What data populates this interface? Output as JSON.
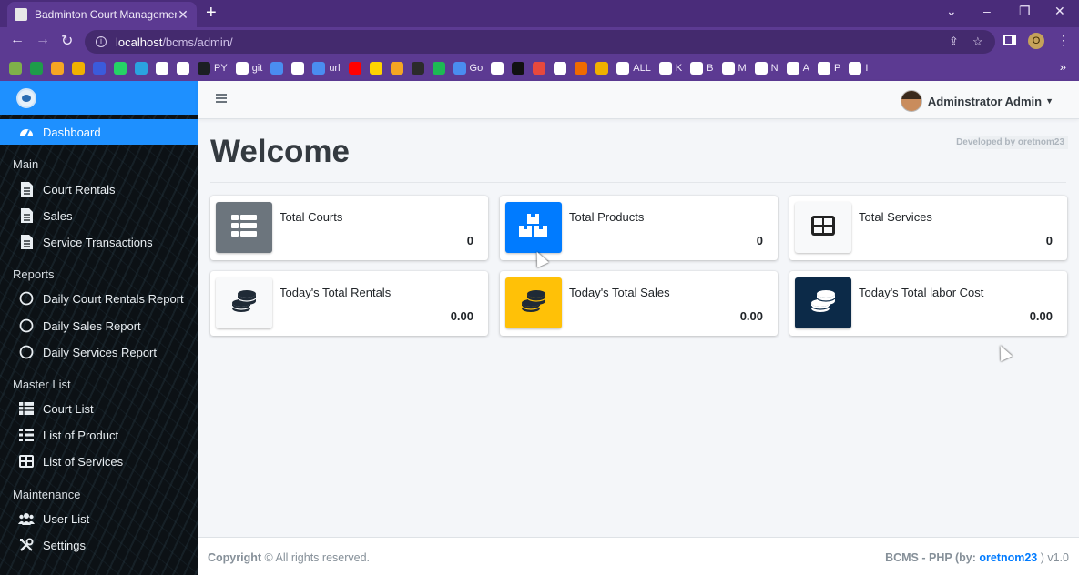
{
  "browser": {
    "tab_title": "Badminton Court Management S",
    "url_host": "localhost",
    "url_path": "/bcms/admin/",
    "profile_initial": "O",
    "bookmarks": [
      {
        "label": "",
        "color": "#7fb04a"
      },
      {
        "label": "",
        "color": "#1e9c4a"
      },
      {
        "label": "",
        "color": "#f5a623"
      },
      {
        "label": "",
        "color": "#f0b000"
      },
      {
        "label": "",
        "color": "#3b5bdb"
      },
      {
        "label": "",
        "color": "#25d366"
      },
      {
        "label": "",
        "color": "#2aa3e0"
      },
      {
        "label": "",
        "color": "#ffffff"
      },
      {
        "label": "",
        "color": "#ffffff"
      },
      {
        "label": "PY",
        "color": "#1b1f23"
      },
      {
        "label": "git",
        "color": "#ffffff"
      },
      {
        "label": "",
        "color": "#4a8df0"
      },
      {
        "label": "",
        "color": "#ffffff"
      },
      {
        "label": "url",
        "color": "#4a8df0"
      },
      {
        "label": "",
        "color": "#ff0000"
      },
      {
        "label": "",
        "color": "#ffd400"
      },
      {
        "label": "",
        "color": "#f5a623"
      },
      {
        "label": "",
        "color": "#2b2b2b"
      },
      {
        "label": "",
        "color": "#1db954"
      },
      {
        "label": "Go",
        "color": "#4a8df0"
      },
      {
        "label": "",
        "color": "#ffffff"
      },
      {
        "label": "",
        "color": "#111111"
      },
      {
        "label": "",
        "color": "#e8493d"
      },
      {
        "label": "",
        "color": "#ffffff"
      },
      {
        "label": "",
        "color": "#f06b00"
      },
      {
        "label": "",
        "color": "#f0b000"
      },
      {
        "label": "ALL",
        "color": "#ffffff"
      },
      {
        "label": "K",
        "color": "#ffffff"
      },
      {
        "label": "B",
        "color": "#ffffff"
      },
      {
        "label": "M",
        "color": "#ffffff"
      },
      {
        "label": "N",
        "color": "#ffffff"
      },
      {
        "label": "A",
        "color": "#ffffff"
      },
      {
        "label": "P",
        "color": "#ffffff"
      },
      {
        "label": "I",
        "color": "#ffffff"
      }
    ]
  },
  "sidebar": {
    "dashboard": "Dashboard",
    "sections": {
      "main": "Main",
      "reports": "Reports",
      "master": "Master List",
      "maintenance": "Maintenance"
    },
    "items": {
      "court_rentals": "Court Rentals",
      "sales": "Sales",
      "service_transactions": "Service Transactions",
      "daily_court_rentals_report": "Daily Court Rentals Report",
      "daily_sales_report": "Daily Sales Report",
      "daily_services_report": "Daily Services Report",
      "court_list": "Court List",
      "list_of_product": "List of Product",
      "list_of_services": "List of Services",
      "user_list": "User List",
      "settings": "Settings"
    },
    "accent": "#1e90ff"
  },
  "header": {
    "user_name": "Adminstrator Admin"
  },
  "main": {
    "title": "Welcome",
    "developed_by": "Developed by oretnom23",
    "cards": [
      {
        "label": "Total Courts",
        "value": "0",
        "icon": "table-icon",
        "bg": "#6c757d"
      },
      {
        "label": "Total Products",
        "value": "0",
        "icon": "boxes-icon",
        "bg": "#007bff"
      },
      {
        "label": "Total Services",
        "value": "0",
        "icon": "grid-icon",
        "bg": "#f8f9fa"
      },
      {
        "label": "Today's Total Rentals",
        "value": "0.00",
        "icon": "coins-icon",
        "bg": "#f8f9fa"
      },
      {
        "label": "Today's Total Sales",
        "value": "0.00",
        "icon": "coins-icon",
        "bg": "#ffc107"
      },
      {
        "label": "Today's Total labor Cost",
        "value": "0.00",
        "icon": "coins-icon",
        "bg": "#0c2a48"
      }
    ]
  },
  "footer": {
    "copyright": "Copyright",
    "rights": " All rights reserved.",
    "app": "BCMS - PHP (by: ",
    "author": "oretnom23",
    "version_suffix": " ) v1.0"
  }
}
